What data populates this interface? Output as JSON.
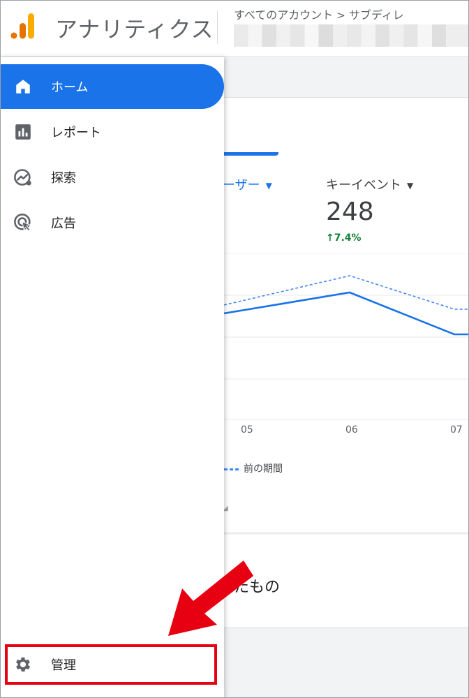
{
  "header": {
    "app_title": "アナリティクス",
    "breadcrumb": [
      "すべてのアカウント",
      "サブディレ"
    ],
    "brand_colors": {
      "logo_dark": "#e37400",
      "logo_light": "#f9ab00"
    }
  },
  "sidebar": {
    "items": [
      {
        "label": "ホーム",
        "icon": "home-icon",
        "active": true
      },
      {
        "label": "レポート",
        "icon": "bar-chart-icon",
        "active": false
      },
      {
        "label": "探索",
        "icon": "explore-icon",
        "active": false
      },
      {
        "label": "広告",
        "icon": "ads-icon",
        "active": false
      }
    ],
    "admin": {
      "label": "管理",
      "icon": "gear-icon"
    },
    "accent": "#1a73e8"
  },
  "main": {
    "metric_users_label": "ーザー",
    "metric_key_label": "キーイベント",
    "metric_key_value": "248",
    "metric_key_change": "7.4%",
    "x_ticks": [
      "05",
      "06",
      "07"
    ],
    "legend_prev": "前の期間",
    "section_title": "たもの"
  },
  "chart_data": {
    "type": "line",
    "categories": [
      "05",
      "06",
      "07"
    ],
    "series": [
      {
        "values": [
          0.45,
          0.7,
          0.2
        ],
        "style": "solid",
        "color": "#1a73e8"
      },
      {
        "name": "前の期間",
        "values": [
          0.55,
          0.9,
          0.5
        ],
        "style": "dashed",
        "color": "#4285f4"
      }
    ],
    "grid": true
  },
  "annotation": {
    "color": "#e60012",
    "target": "管理"
  }
}
